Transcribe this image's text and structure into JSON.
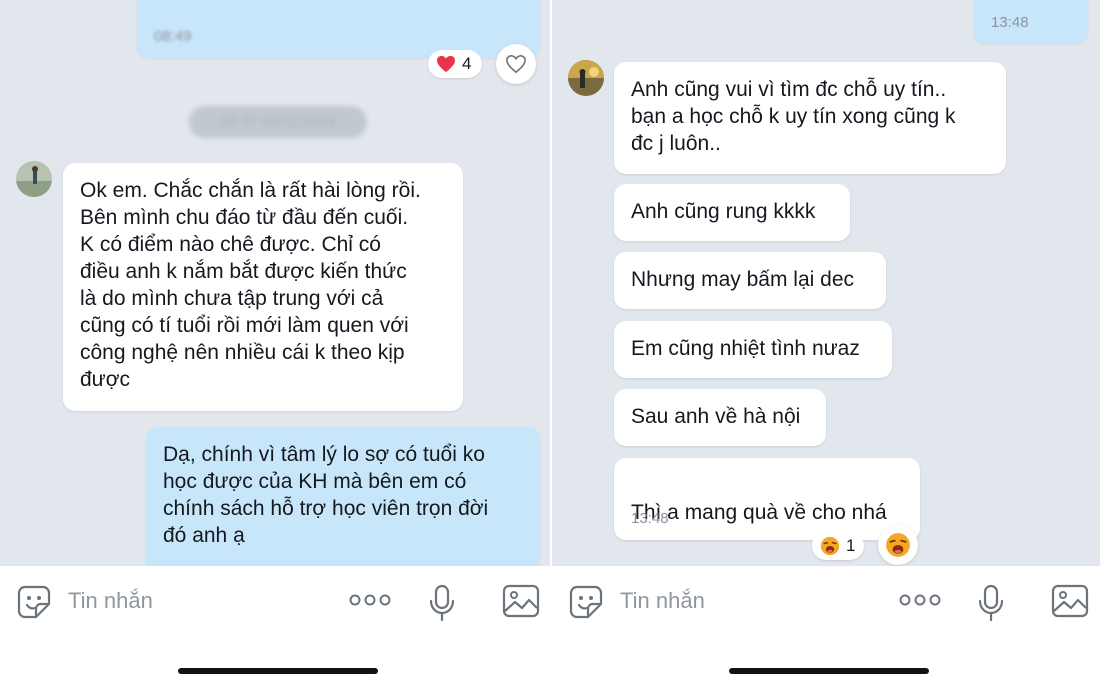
{
  "left": {
    "top_bubble_time": "08:49",
    "top_reaction": {
      "emoji": "heart",
      "count": "4"
    },
    "date_separator": "09:37 05/11/2024",
    "incoming_message": "Ok em. Chắc chắn là rất hài lòng rồi.\nBên mình chu đáo từ đầu đến cuối.\nK có điểm nào chê được. Chỉ có\nđiều anh k nắm bắt được kiến thức\nlà do mình chưa tập trung với cả\ncũng có tí tuổi rồi mới làm quen với\ncông nghệ nên nhiều cái k theo kịp\nđược",
    "outgoing_message": "Dạ, chính vì tâm lý lo sợ có tuổi ko\nhọc được của KH mà bên em có\nchính sách hỗ trợ học viên trọn đời\nđó anh ạ",
    "input_placeholder": "Tin nhắn"
  },
  "right": {
    "top_bubble_time": "13:48",
    "messages": [
      "Anh cũng vui vì tìm đc chỗ uy tín..\nbạn a học chỗ k uy tín xong cũng k\nđc j luôn..",
      "Anh cũng rung kkkk",
      "Nhưng may bấm lại dec",
      "Em cũng nhiệt tình nưaz",
      "Sau anh về hà nội",
      "Thì a mang quà về cho nhá"
    ],
    "last_message_time": "13:48",
    "last_reaction": {
      "emoji": "laughing-crying",
      "count": "1"
    },
    "input_placeholder": "Tin nhắn"
  },
  "colors": {
    "chat_background": "#e2e7ee",
    "incoming_bubble": "#ffffff",
    "outgoing_bubble": "#c8e6f9",
    "heart": "#e8334a",
    "icon_gray": "#6b737c"
  }
}
